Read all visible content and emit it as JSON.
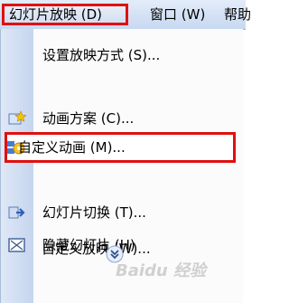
{
  "menubar": {
    "items": [
      {
        "label": "幻灯片放映 (D)"
      },
      {
        "label": "窗口 (W)"
      },
      {
        "label": "帮助"
      }
    ]
  },
  "menu": {
    "items": [
      {
        "label": "设置放映方式 (S)...",
        "icon": "none"
      },
      {
        "label": "动画方案 (C)...",
        "icon": "star-icon"
      },
      {
        "label": "自定义动画 (M)...",
        "icon": "custom-animation-icon"
      },
      {
        "label": "幻灯片切换 (T)...",
        "icon": "slide-transition-icon"
      },
      {
        "label": "隐藏幻灯片 (H)",
        "icon": "hide-slide-icon"
      },
      {
        "label": "自定义放映 (W)...",
        "icon": "none"
      }
    ],
    "expand_icon": "double-chevron-down-icon"
  },
  "watermark": {
    "text": "Baidu 经验"
  },
  "colors": {
    "highlight_border": "#e01010",
    "menubar_bg": "#d3e0f4",
    "icon_strip": "#d2def2"
  }
}
